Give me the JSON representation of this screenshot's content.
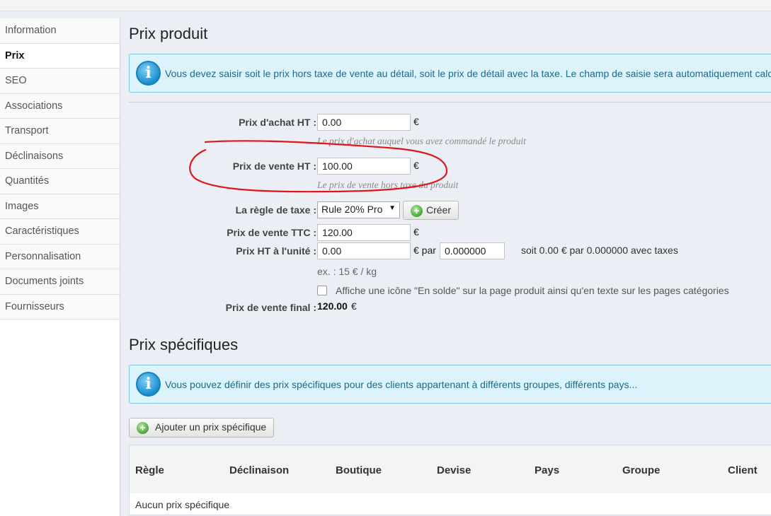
{
  "sidebar": {
    "items": [
      {
        "label": "Information",
        "active": false
      },
      {
        "label": "Prix",
        "active": true
      },
      {
        "label": "SEO",
        "active": false
      },
      {
        "label": "Associations",
        "active": false
      },
      {
        "label": "Transport",
        "active": false
      },
      {
        "label": "Déclinaisons",
        "active": false
      },
      {
        "label": "Quantités",
        "active": false
      },
      {
        "label": "Images",
        "active": false
      },
      {
        "label": "Caractéristiques",
        "active": false
      },
      {
        "label": "Personnalisation",
        "active": false
      },
      {
        "label": "Documents joints",
        "active": false
      },
      {
        "label": "Fournisseurs",
        "active": false
      }
    ]
  },
  "price_section": {
    "title": "Prix produit",
    "info": "Vous devez saisir soit le prix hors taxe de vente au détail, soit le prix de détail avec la taxe. Le champ de saisie sera automatiquement calculé.",
    "wholesale": {
      "label": "Prix d'achat HT :",
      "value": "0.00",
      "currency": "€",
      "hint": "Le prix d'achat auquel vous avez commandé le produit"
    },
    "retail": {
      "label": "Prix de vente HT :",
      "value": "100.00",
      "currency": "€",
      "hint": "Le prix de vente hors taxe du produit"
    },
    "tax_rule": {
      "label": "La règle de taxe :",
      "selected": "Rule 20% Pro",
      "create_label": "Créer"
    },
    "retail_ttc": {
      "label": "Prix de vente TTC :",
      "value": "120.00",
      "currency": "€"
    },
    "unit_price": {
      "label": "Prix HT à l'unité :",
      "value": "0.00",
      "currency_par": "€ par",
      "unit_value": "0.000000",
      "summary": "soit 0.00 € par 0.000000 avec taxes",
      "example": "ex. : 15 € / kg"
    },
    "on_sale": {
      "label": "Affiche une icône \"En solde\" sur la page produit ainsi qu'en texte sur les pages catégories",
      "checked": false
    },
    "final": {
      "label": "Prix de vente final :",
      "value": "120.00",
      "currency": "€"
    }
  },
  "specific_section": {
    "title": "Prix spécifiques",
    "info": "Vous pouvez définir des prix spécifiques pour des clients appartenant à différents groupes, différents pays...",
    "add_button": "Ajouter un prix spécifique",
    "columns": [
      "Règle",
      "Déclinaison",
      "Boutique",
      "Devise",
      "Pays",
      "Groupe",
      "Client"
    ],
    "empty": "Aucun prix spécifique"
  },
  "colors": {
    "accent_info": "#1b6a8a",
    "annotation": "#e0151a"
  }
}
